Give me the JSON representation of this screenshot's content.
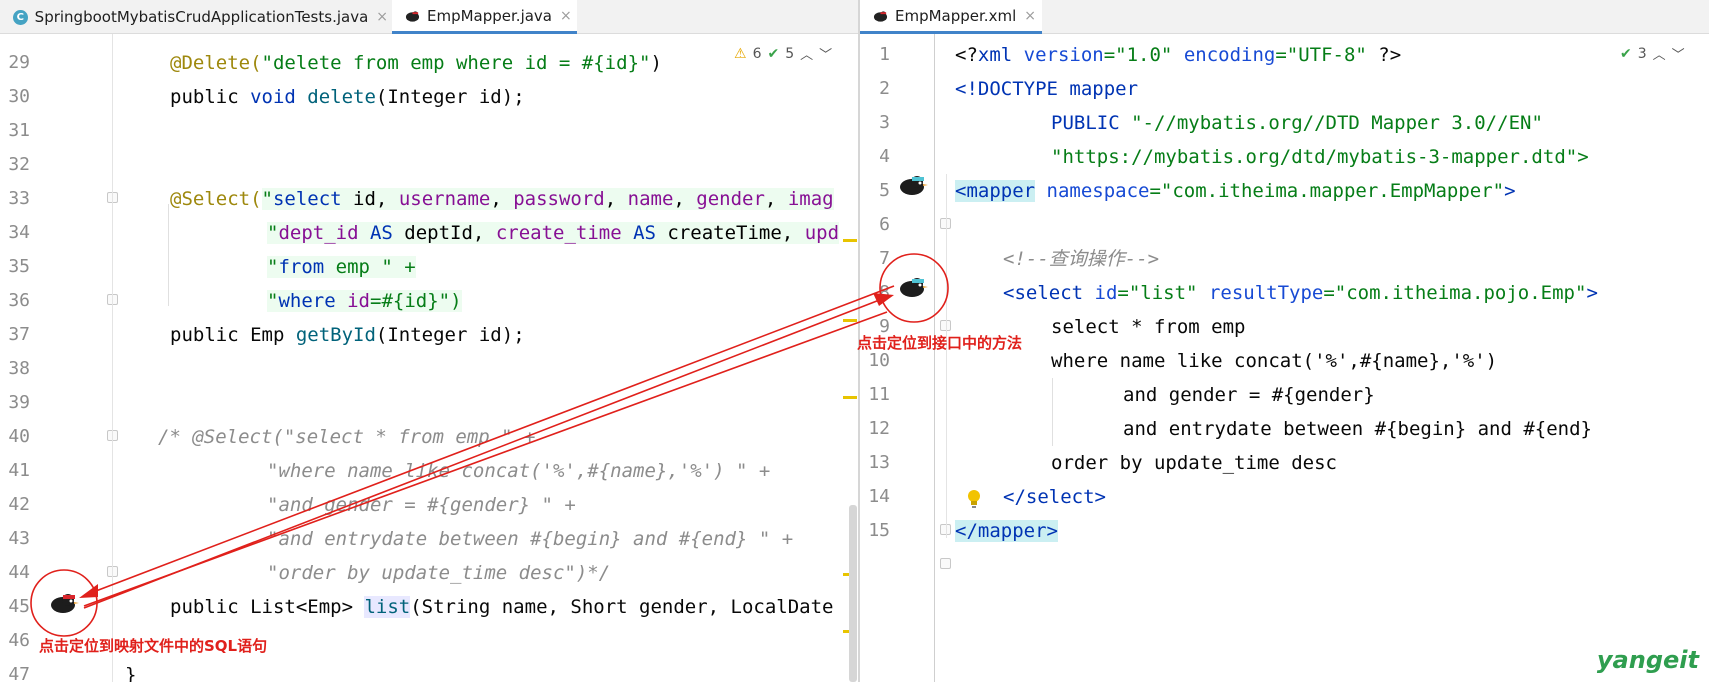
{
  "left_tabs": [
    {
      "label": "SpringbootMybatisCrudApplicationTests.java",
      "icon": "c-class-icon",
      "active": false
    },
    {
      "label": "EmpMapper.java",
      "icon": "mybatis-bird-icon",
      "active": true
    }
  ],
  "right_tabs": [
    {
      "label": "EmpMapper.xml",
      "icon": "mybatis-bird-icon",
      "active": true
    }
  ],
  "left_inspections": {
    "warnings": "6",
    "ok": "5"
  },
  "right_inspections": {
    "ok": "3"
  },
  "close_glyph": "×",
  "left_line_numbers": [
    "29",
    "30",
    "31",
    "32",
    "33",
    "34",
    "35",
    "36",
    "37",
    "38",
    "39",
    "40",
    "41",
    "42",
    "43",
    "44",
    "45",
    "46",
    "47"
  ],
  "right_line_numbers": [
    "1",
    "2",
    "3",
    "4",
    "5",
    "6",
    "7",
    "8",
    "9",
    "10",
    "11",
    "12",
    "13",
    "14",
    "15"
  ],
  "left_code": {
    "l29": {
      "a": "@Delete(",
      "b": "\"delete from emp where id = #{id}\"",
      "c": ")"
    },
    "l30": {
      "a": "public ",
      "b": "void ",
      "c": "delete",
      "d": "(Integer id);"
    },
    "l33": {
      "a": "@Select(",
      "b": "\"",
      "c": "select",
      "d": " id, ",
      "e": "username",
      "f": ", ",
      "g": "password",
      "h": ", ",
      "i": "name",
      "j": ", ",
      "k": "gender",
      "l": ", ",
      "m": "imag"
    },
    "l34": {
      "a": "\"",
      "b": "dept_id",
      "c": " AS ",
      "d": "deptId, ",
      "e": "create_time",
      "f": " AS ",
      "g": "createTime, ",
      "h": "upd"
    },
    "l35": {
      "a": "\"",
      "b": "from",
      "c": " emp \" +"
    },
    "l36": {
      "a": "\"",
      "b": "where",
      "c": " ",
      "d": "id",
      "e": "=#{id}\")"
    },
    "l37": {
      "a": "public ",
      "b": "Emp ",
      "c": "getById",
      "d": "(Integer id);"
    },
    "l40": "/* @Select(\"select * from emp \" +",
    "l41": "\"where name like concat('%',#{name},'%') \" +",
    "l42": "\"and gender = #{gender} \" +",
    "l43": "\"and entrydate between #{begin} and #{end} \" +",
    "l44": "\"order by update_time desc\")*/",
    "l45": {
      "a": "public ",
      "b": "List<Emp> ",
      "c": "list",
      "d": "(String name, Short gender, LocalDate"
    },
    "l47": "}"
  },
  "right_code": {
    "r1": {
      "a": "<?",
      "b": "xml ",
      "c": "version",
      "d": "=\"1.0\" ",
      "e": "encoding",
      "f": "=\"UTF-8\" ",
      "g": "?>"
    },
    "r2": {
      "a": "<!DOCTYPE ",
      "b": "mapper"
    },
    "r3": {
      "a": "PUBLIC ",
      "b": "\"-//mybatis.org//DTD Mapper 3.0//EN\""
    },
    "r4": "\"https://mybatis.org/dtd/mybatis-3-mapper.dtd\">",
    "r5": {
      "a": "<",
      "b": "mapper",
      "c": " namespace",
      "d": "=\"com.itheima.mapper.EmpMapper\"",
      "e": ">"
    },
    "r7": "<!--查询操作-->",
    "r8": {
      "a": "<",
      "b": "select",
      "c": " id",
      "d": "=\"list\" ",
      "e": "resultType",
      "f": "=\"com.itheima.pojo.Emp\"",
      "g": ">"
    },
    "r9": "select * from emp",
    "r10": "where name like concat('%',#{name},'%')",
    "r11": "and gender = #{gender}",
    "r12": "and entrydate between #{begin} and #{end}",
    "r13": "order by update_time desc",
    "r14": {
      "a": "</",
      "b": "select",
      "c": ">"
    },
    "r15": {
      "a": "</",
      "b": "mapper",
      "c": ">"
    }
  },
  "callouts": {
    "right": "点击定位到接口中的方法",
    "left": "点击定位到映射文件中的SQL语句"
  },
  "watermark": "yangeit",
  "colors": {
    "annotation_red": "#e0201b",
    "tab_accent": "#4083c9",
    "watermark_green": "#2f9e4f"
  }
}
